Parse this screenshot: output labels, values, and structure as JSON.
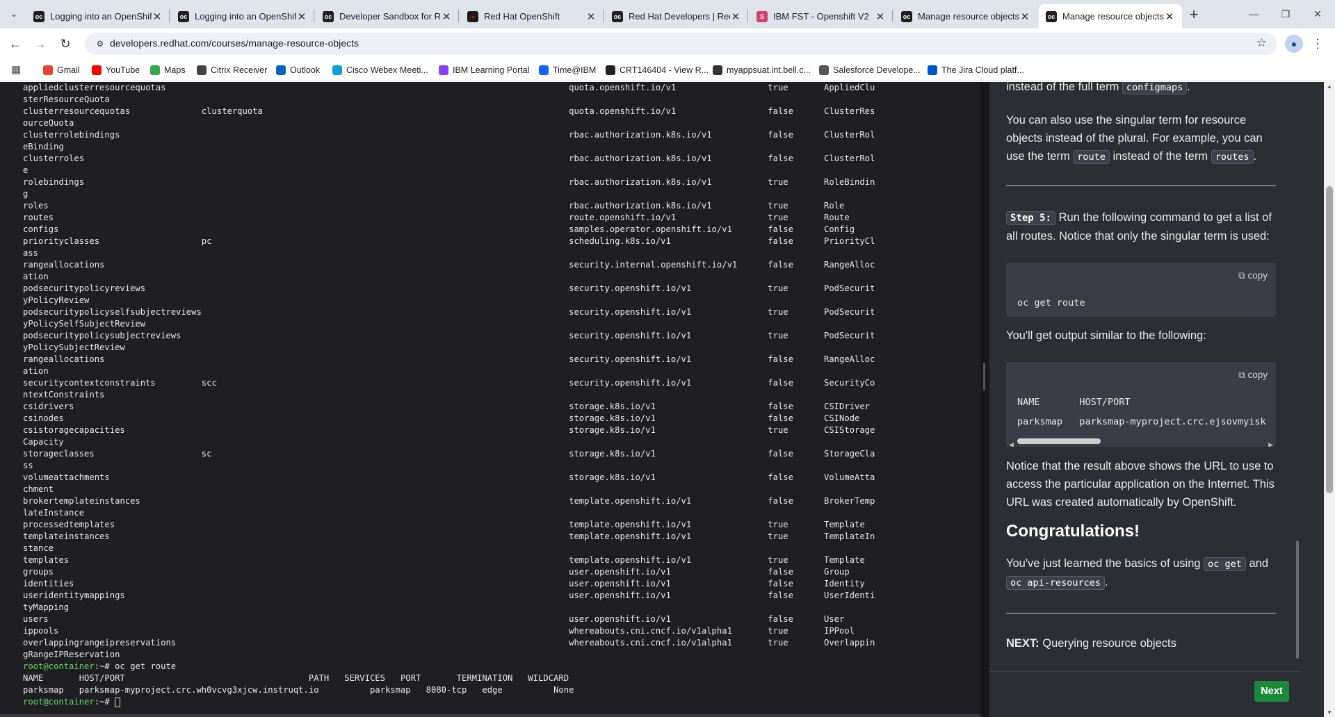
{
  "browser": {
    "tabs": [
      {
        "label": "Logging into an OpenShift",
        "icon": "ocp"
      },
      {
        "label": "Logging into an OpenShift",
        "icon": "ocp"
      },
      {
        "label": "Developer Sandbox for Re",
        "icon": "ocp"
      },
      {
        "label": "Red Hat OpenShift",
        "icon": "rh"
      },
      {
        "label": "Red Hat Developers | Red",
        "icon": "ocp"
      },
      {
        "label": "IBM FST - Openshift V2",
        "icon": "ibm"
      },
      {
        "label": "Manage resource objects",
        "icon": "ocp"
      },
      {
        "label": "Manage resource objects",
        "icon": "ocp"
      }
    ],
    "url": "developers.redhat.com/courses/manage-resource-objects",
    "bookmarks": [
      {
        "label": "Gmail",
        "color": "#ea4335"
      },
      {
        "label": "YouTube",
        "color": "#ff0000"
      },
      {
        "label": "Maps",
        "color": "#34a853"
      },
      {
        "label": "Citrix Receiver",
        "color": "#444444"
      },
      {
        "label": "Outlook",
        "color": "#0a64c8"
      },
      {
        "label": "Cisco Webex Meeti...",
        "color": "#0aa1d8"
      },
      {
        "label": "IBM Learning Portal",
        "color": "#8a3ffc"
      },
      {
        "label": "Time@IBM",
        "color": "#0f62fe"
      },
      {
        "label": "CRT146404 - View R...",
        "color": "#222222"
      },
      {
        "label": "myappsuat.int.bell.c...",
        "color": "#333333"
      },
      {
        "label": "Salesforce Develope...",
        "color": "#555555"
      },
      {
        "label": "The Jira Cloud platf...",
        "color": "#0052cc"
      }
    ]
  },
  "terminal": {
    "rows": [
      [
        "appliedclusterresourcequotas",
        "",
        "quota.openshift.io/v1",
        "true",
        "AppliedClu"
      ],
      [
        "sterResourceQuota",
        "",
        "",
        "",
        ""
      ],
      [
        "clusterresourcequotas",
        "clusterquota",
        "quota.openshift.io/v1",
        "false",
        "ClusterRes"
      ],
      [
        "ourceQuota",
        "",
        "",
        "",
        ""
      ],
      [
        "clusterrolebindings",
        "",
        "rbac.authorization.k8s.io/v1",
        "false",
        "ClusterRol"
      ],
      [
        "eBinding",
        "",
        "",
        "",
        ""
      ],
      [
        "clusterroles",
        "",
        "rbac.authorization.k8s.io/v1",
        "false",
        "ClusterRol"
      ],
      [
        "e",
        "",
        "",
        "",
        ""
      ],
      [
        "rolebindings",
        "",
        "rbac.authorization.k8s.io/v1",
        "true",
        "RoleBindin"
      ],
      [
        "g",
        "",
        "",
        "",
        ""
      ],
      [
        "roles",
        "",
        "rbac.authorization.k8s.io/v1",
        "true",
        "Role"
      ],
      [
        "routes",
        "",
        "route.openshift.io/v1",
        "true",
        "Route"
      ],
      [
        "configs",
        "",
        "samples.operator.openshift.io/v1",
        "false",
        "Config"
      ],
      [
        "priorityclasses",
        "pc",
        "scheduling.k8s.io/v1",
        "false",
        "PriorityCl"
      ],
      [
        "ass",
        "",
        "",
        "",
        ""
      ],
      [
        "rangeallocations",
        "",
        "security.internal.openshift.io/v1",
        "false",
        "RangeAlloc"
      ],
      [
        "ation",
        "",
        "",
        "",
        ""
      ],
      [
        "podsecuritypolicyreviews",
        "",
        "security.openshift.io/v1",
        "true",
        "PodSecurit"
      ],
      [
        "yPolicyReview",
        "",
        "",
        "",
        ""
      ],
      [
        "podsecuritypolicyselfsubjectreviews",
        "",
        "security.openshift.io/v1",
        "true",
        "PodSecurit"
      ],
      [
        "yPolicySelfSubjectReview",
        "",
        "",
        "",
        ""
      ],
      [
        "podsecuritypolicysubjectreviews",
        "",
        "security.openshift.io/v1",
        "true",
        "PodSecurit"
      ],
      [
        "yPolicySubjectReview",
        "",
        "",
        "",
        ""
      ],
      [
        "rangeallocations",
        "",
        "security.openshift.io/v1",
        "false",
        "RangeAlloc"
      ],
      [
        "ation",
        "",
        "",
        "",
        ""
      ],
      [
        "securitycontextconstraints",
        "scc",
        "security.openshift.io/v1",
        "false",
        "SecurityCo"
      ],
      [
        "ntextConstraints",
        "",
        "",
        "",
        ""
      ],
      [
        "csidrivers",
        "",
        "storage.k8s.io/v1",
        "false",
        "CSIDriver"
      ],
      [
        "csinodes",
        "",
        "storage.k8s.io/v1",
        "false",
        "CSINode"
      ],
      [
        "csistoragecapacities",
        "",
        "storage.k8s.io/v1",
        "true",
        "CSIStorage"
      ],
      [
        "Capacity",
        "",
        "",
        "",
        ""
      ],
      [
        "storageclasses",
        "sc",
        "storage.k8s.io/v1",
        "false",
        "StorageCla"
      ],
      [
        "ss",
        "",
        "",
        "",
        ""
      ],
      [
        "volumeattachments",
        "",
        "storage.k8s.io/v1",
        "false",
        "VolumeAtta"
      ],
      [
        "chment",
        "",
        "",
        "",
        ""
      ],
      [
        "brokertemplateinstances",
        "",
        "template.openshift.io/v1",
        "false",
        "BrokerTemp"
      ],
      [
        "lateInstance",
        "",
        "",
        "",
        ""
      ],
      [
        "processedtemplates",
        "",
        "template.openshift.io/v1",
        "true",
        "Template"
      ],
      [
        "templateinstances",
        "",
        "template.openshift.io/v1",
        "true",
        "TemplateIn"
      ],
      [
        "stance",
        "",
        "",
        "",
        ""
      ],
      [
        "templates",
        "",
        "template.openshift.io/v1",
        "true",
        "Template"
      ],
      [
        "groups",
        "",
        "user.openshift.io/v1",
        "false",
        "Group"
      ],
      [
        "identities",
        "",
        "user.openshift.io/v1",
        "false",
        "Identity"
      ],
      [
        "useridentitymappings",
        "",
        "user.openshift.io/v1",
        "false",
        "UserIdenti"
      ],
      [
        "tyMapping",
        "",
        "",
        "",
        ""
      ],
      [
        "users",
        "",
        "user.openshift.io/v1",
        "false",
        "User"
      ],
      [
        "ippools",
        "",
        "whereabouts.cni.cncf.io/v1alpha1",
        "true",
        "IPPool"
      ],
      [
        "overlappingrangeipreservations",
        "",
        "whereabouts.cni.cncf.io/v1alpha1",
        "true",
        "Overlappin"
      ],
      [
        "gRangeIPReservation",
        "",
        "",
        "",
        ""
      ]
    ],
    "prompt": "root@container",
    "prompt_suffix": ":~# ",
    "command": "oc get route",
    "route_header": "NAME       HOST/PORT                                    PATH   SERVICES   PORT       TERMINATION   WILDCARD",
    "route_row": "parksmap   parksmap-myproject.crc.wh0vcvg3xjcw.instruqt.io          parksmap   8080-tcp   edge          None"
  },
  "panel": {
    "para_top_pre": "instead of the full term ",
    "para_top_code": "configmaps",
    "para_top_post": ".",
    "para_singular_1": "You can also use the singular term for resource objects instead of the plural. For example, you can use the term ",
    "para_singular_code1": "route",
    "para_singular_mid": " instead of the term ",
    "para_singular_code2": "routes",
    "para_singular_end": ".",
    "step_badge": "Step 5:",
    "step_text": " Run the following command to get a list of all routes. Notice that only the singular term is used:",
    "copy_label": "copy",
    "code_command": "oc get route",
    "output_intro": "You'll get output similar to the following:",
    "output_header": "NAME       HOST/PORT",
    "output_row": "parksmap   parksmap-myproject.crc.ejsovmyisk",
    "notice": "Notice that the result above shows the URL to use to access the particular application on the Internet. This URL was created automatically by OpenShift.",
    "congrats": "Congratulations!",
    "learned_pre": "You've just learned the basics of using ",
    "learned_code1": "oc get",
    "learned_mid": " and ",
    "learned_code2": "oc api-resources",
    "learned_end": ".",
    "next_label": "NEXT:",
    "next_text": " Querying resource objects",
    "next_button": "Next"
  }
}
